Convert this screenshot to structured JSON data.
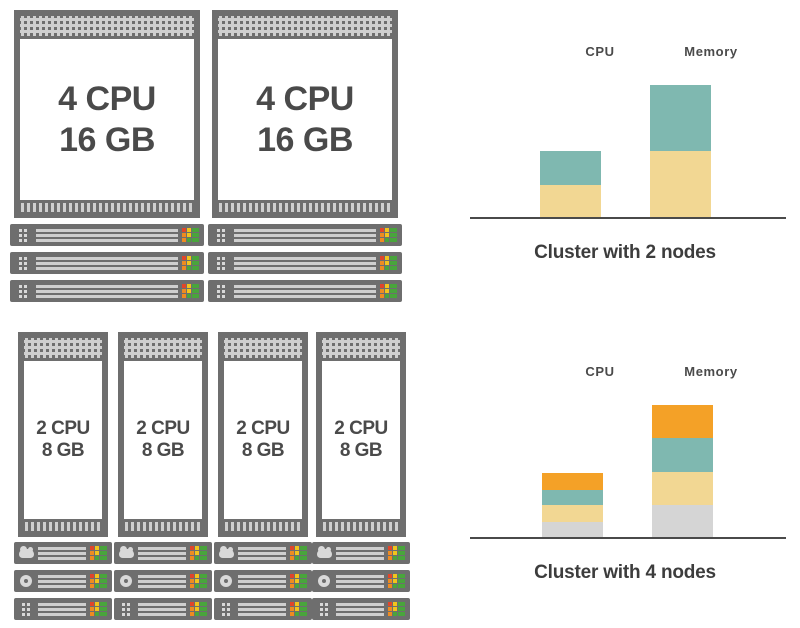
{
  "palette": {
    "node_frame": "#6e6e6e",
    "node_text": "#4a4a4a",
    "rack_body": "#6e6e6e",
    "rack_bar": "#cfcfcf",
    "led_red": "#e2452a",
    "led_orange": "#ef8b20",
    "led_yellow": "#f2c41c",
    "led_green": "#49a53c",
    "seg_teal": "#7fb8b0",
    "seg_yellow": "#f2d793",
    "seg_orange": "#f4a127",
    "seg_gray": "#d5d5d5",
    "axis": "#4a4a4a",
    "caption_text": "#3d3d3d",
    "background": "#ffffff"
  },
  "top_group": {
    "name": "two-node-cluster",
    "nodes": [
      {
        "cpu_line": "4 CPU",
        "mem_line": "16 GB",
        "rack_units": [
          {
            "icon": "dot-grid-icon"
          },
          {
            "icon": "dot-grid-icon"
          },
          {
            "icon": "dot-grid-icon"
          }
        ]
      },
      {
        "cpu_line": "4 CPU",
        "mem_line": "16 GB",
        "rack_units": [
          {
            "icon": "dot-grid-icon"
          },
          {
            "icon": "dot-grid-icon"
          },
          {
            "icon": "dot-grid-icon"
          }
        ]
      }
    ]
  },
  "bottom_group": {
    "name": "four-node-cluster",
    "nodes": [
      {
        "cpu_line": "2 CPU",
        "mem_line": "8 GB",
        "rack_units": [
          {
            "icon": "cloud-icon"
          },
          {
            "icon": "disc-icon"
          },
          {
            "icon": "dot-grid-icon"
          }
        ]
      },
      {
        "cpu_line": "2 CPU",
        "mem_line": "8 GB",
        "rack_units": [
          {
            "icon": "cloud-icon"
          },
          {
            "icon": "disc-icon"
          },
          {
            "icon": "dot-grid-icon"
          }
        ]
      },
      {
        "cpu_line": "2 CPU",
        "mem_line": "8 GB",
        "rack_units": [
          {
            "icon": "cloud-icon"
          },
          {
            "icon": "disc-icon"
          },
          {
            "icon": "dot-grid-icon"
          }
        ]
      },
      {
        "cpu_line": "2 CPU",
        "mem_line": "8 GB",
        "rack_units": [
          {
            "icon": "cloud-icon"
          },
          {
            "icon": "disc-icon"
          },
          {
            "icon": "dot-grid-icon"
          }
        ]
      }
    ]
  },
  "chart_data": [
    {
      "id": "cluster-2-nodes-chart",
      "type": "bar",
      "stacked": true,
      "title": "Cluster with 2 nodes",
      "categories": [
        "CPU",
        "Memory"
      ],
      "xlabel": "",
      "ylabel": "",
      "grid": false,
      "legend": "none",
      "axis_baseline": true,
      "ylim": [
        0,
        160
      ],
      "unit_note": "bar height in pixels as drawn",
      "series": [
        {
          "name": "node-1",
          "color": "#f2d793",
          "values": [
            32,
            66
          ]
        },
        {
          "name": "node-2",
          "color": "#7fb8b0",
          "values": [
            34,
            66
          ]
        }
      ],
      "totals": [
        66,
        132
      ]
    },
    {
      "id": "cluster-4-nodes-chart",
      "type": "bar",
      "stacked": true,
      "title": "Cluster with 4 nodes",
      "categories": [
        "CPU",
        "Memory"
      ],
      "xlabel": "",
      "ylabel": "",
      "grid": false,
      "legend": "none",
      "axis_baseline": true,
      "ylim": [
        0,
        160
      ],
      "unit_note": "bar height in pixels as drawn",
      "series": [
        {
          "name": "node-1",
          "color": "#d5d5d5",
          "values": [
            15,
            32
          ]
        },
        {
          "name": "node-2",
          "color": "#f2d793",
          "values": [
            17,
            33
          ]
        },
        {
          "name": "node-3",
          "color": "#7fb8b0",
          "values": [
            15,
            34
          ]
        },
        {
          "name": "node-4",
          "color": "#f4a127",
          "values": [
            17,
            33
          ]
        }
      ],
      "totals": [
        64,
        132
      ]
    }
  ]
}
